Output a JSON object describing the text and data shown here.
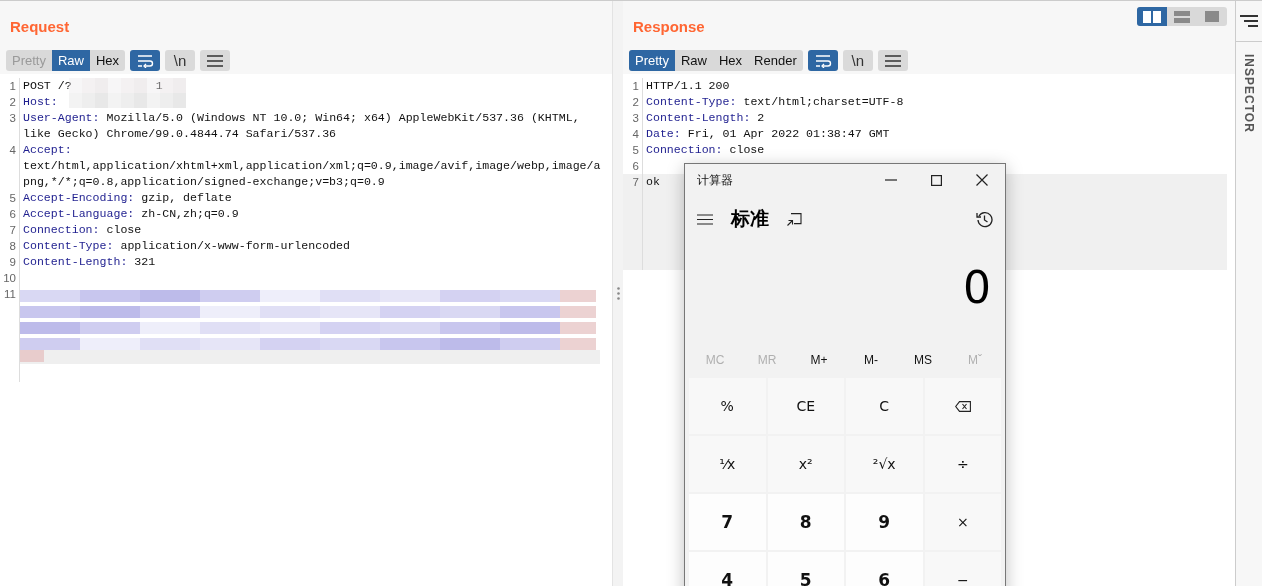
{
  "request": {
    "title": "Request",
    "view_tabs": [
      {
        "label": "Pretty",
        "selected": false,
        "disabled": true
      },
      {
        "label": "Raw",
        "selected": true,
        "disabled": false
      },
      {
        "label": "Hex",
        "selected": false,
        "disabled": false
      }
    ],
    "tools": [
      {
        "kind": "wrap",
        "selected": true
      },
      {
        "kind": "newline",
        "label": "\\n",
        "selected": false
      },
      {
        "kind": "menu",
        "selected": false
      }
    ],
    "lines": [
      {
        "num": "1",
        "value": "POST /?",
        "tail": "1",
        "redacted": true
      },
      {
        "num": "2",
        "key": "Host:"
      },
      {
        "num": "3",
        "key": "User-Agent:",
        "value": "Mozilla/5.0 (Windows NT 10.0; Win64; x64) AppleWebKit/537.36 (KHTML, like Gecko) Chrome/99.0.4844.74 Safari/537.36"
      },
      {
        "num": "4",
        "key": "Accept:",
        "value": "text/html,application/xhtml+xml,application/xml;q=0.9,image/avif,image/webp,image/apng,*/*;q=0.8,application/signed-exchange;v=b3;q=0.9"
      },
      {
        "num": "5",
        "key": "Accept-Encoding:",
        "value": "gzip, deflate"
      },
      {
        "num": "6",
        "key": "Accept-Language:",
        "value": "zh-CN,zh;q=0.9"
      },
      {
        "num": "7",
        "key": "Connection:",
        "value": "close"
      },
      {
        "num": "8",
        "key": "Content-Type:",
        "value": "application/x-www-form-urlencoded"
      },
      {
        "num": "9",
        "key": "Content-Length:",
        "value": "321"
      },
      {
        "num": "10"
      },
      {
        "num": "11",
        "redacted": true
      }
    ]
  },
  "response": {
    "title": "Response",
    "view_tabs": [
      {
        "label": "Pretty",
        "selected": true,
        "disabled": false
      },
      {
        "label": "Raw",
        "selected": false,
        "disabled": false
      },
      {
        "label": "Hex",
        "selected": false,
        "disabled": false
      },
      {
        "label": "Render",
        "selected": false,
        "disabled": false
      }
    ],
    "tools": [
      {
        "kind": "wrap",
        "selected": true
      },
      {
        "kind": "newline",
        "label": "\\n",
        "selected": false
      },
      {
        "kind": "menu",
        "selected": false
      }
    ],
    "lines": [
      {
        "num": "1",
        "value": "HTTP/1.1 200"
      },
      {
        "num": "2",
        "key": "Content-Type:",
        "value": "text/html;charset=UTF-8"
      },
      {
        "num": "3",
        "key": "Content-Length:",
        "value": "2"
      },
      {
        "num": "4",
        "key": "Date:",
        "value": "Fri, 01 Apr 2022 01:38:47 GMT"
      },
      {
        "num": "5",
        "key": "Connection:",
        "value": "close"
      },
      {
        "num": "6"
      },
      {
        "num": "7",
        "value": "ok",
        "highlighted": true
      }
    ]
  },
  "layout_buttons": [
    {
      "kind": "side-by-side",
      "selected": true
    },
    {
      "kind": "stacked",
      "selected": false
    },
    {
      "kind": "single",
      "selected": false
    }
  ],
  "sidebar": {
    "label": "INSPECTOR"
  },
  "calculator": {
    "title": "计算器",
    "mode": "标准",
    "display": "0",
    "memory": [
      {
        "label": "MC",
        "disabled": true
      },
      {
        "label": "MR",
        "disabled": true
      },
      {
        "label": "M+",
        "disabled": false
      },
      {
        "label": "M-",
        "disabled": false
      },
      {
        "label": "MS",
        "disabled": false
      },
      {
        "label": "Mˇ",
        "disabled": true
      }
    ],
    "keys": [
      {
        "kind": "fn",
        "label": "%"
      },
      {
        "kind": "fn",
        "label": "CE"
      },
      {
        "kind": "fn",
        "label": "C"
      },
      {
        "kind": "backspace"
      },
      {
        "kind": "fn",
        "label": "⅟x"
      },
      {
        "kind": "fn",
        "label": "x²"
      },
      {
        "kind": "fn",
        "label": "²√x"
      },
      {
        "kind": "fn",
        "label": "÷"
      },
      {
        "kind": "digit",
        "label": "7"
      },
      {
        "kind": "digit",
        "label": "8"
      },
      {
        "kind": "digit",
        "label": "9"
      },
      {
        "kind": "fn",
        "label": "×"
      },
      {
        "kind": "digit",
        "label": "4"
      },
      {
        "kind": "digit",
        "label": "5"
      },
      {
        "kind": "digit",
        "label": "6"
      },
      {
        "kind": "fn",
        "label": "−"
      }
    ]
  }
}
